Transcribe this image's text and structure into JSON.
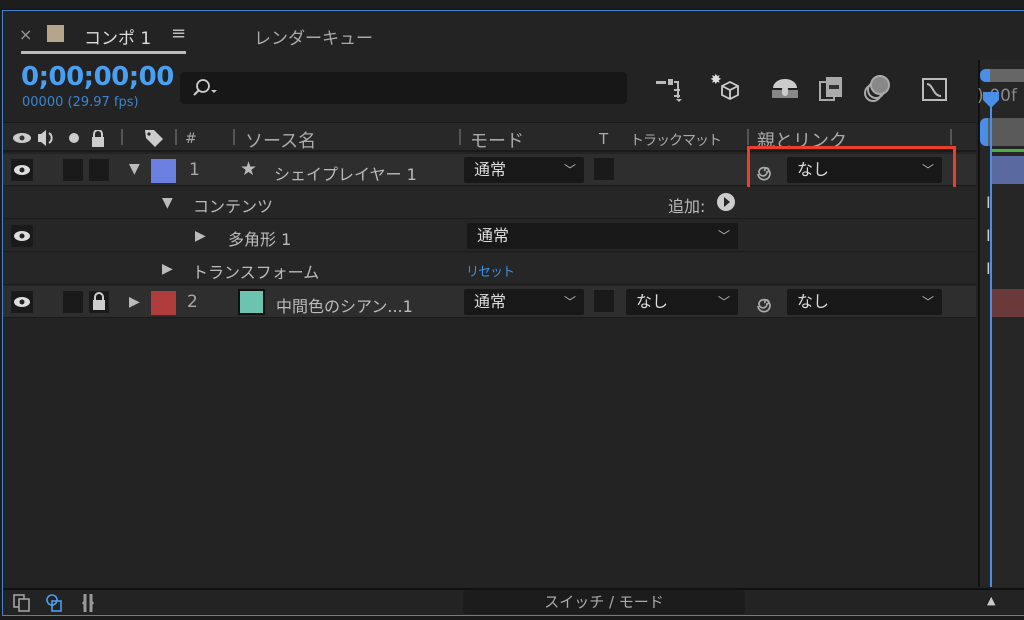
{
  "tabs": {
    "close": "×",
    "comp": "コンポ 1",
    "menu": "≡",
    "render": "レンダーキュー",
    "comp_color": "#b5a58a"
  },
  "time": {
    "timecode": "0;00;00;00",
    "frames": "00000 (29.97 fps)",
    "ruler": "):00f"
  },
  "search": {
    "icon": "search-icon"
  },
  "columns": {
    "name": "ソース名",
    "mode": "モード",
    "t": "T",
    "matte": "トラックマット",
    "parent": "親とリンク",
    "num": "#"
  },
  "layers": [
    {
      "num": "1",
      "name": "シェイプレイヤー 1",
      "mode": "通常",
      "parent": "なし",
      "color": "#6b7fe0",
      "icon": "star-icon"
    },
    {
      "num": "2",
      "name": "中間色のシアン...1",
      "mode": "通常",
      "matte": "なし",
      "parent": "なし",
      "color": "#b03c3c",
      "swatch": "#6cc4b0"
    }
  ],
  "contents": {
    "label": "コンテンツ",
    "add": "追加:"
  },
  "polygon": {
    "label": "多角形 1",
    "mode": "通常"
  },
  "transform": {
    "label": "トランスフォーム",
    "reset": "リセット"
  },
  "footer": {
    "toggle": "スイッチ / モード"
  },
  "accent": "#4a9ff0",
  "highlight": "#e8402a"
}
